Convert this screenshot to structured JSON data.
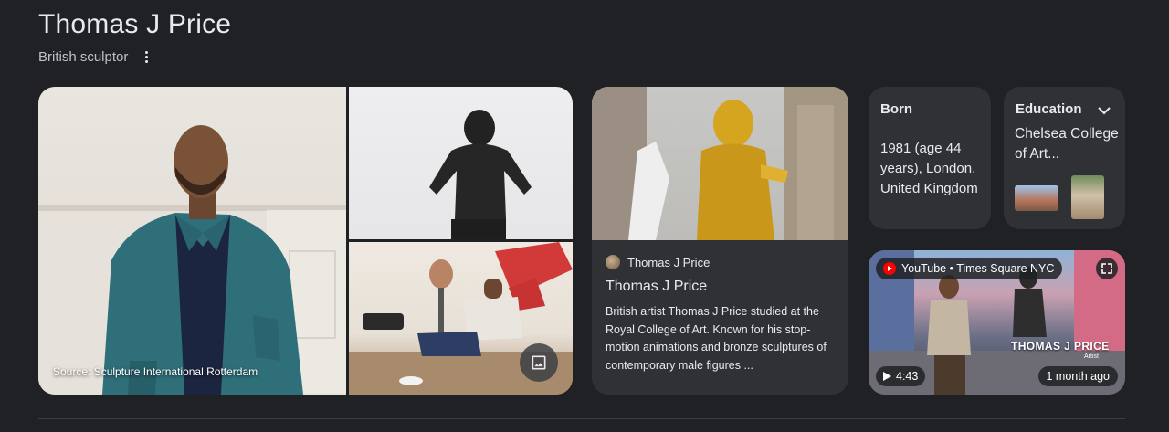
{
  "header": {
    "title": "Thomas J Price",
    "subtitle": "British sculptor"
  },
  "gallery": {
    "source_text": "Source: Sculpture International Rotterdam"
  },
  "article": {
    "source_name": "Thomas J Price",
    "title": "Thomas J Price",
    "snippet": "British artist Thomas J Price studied at the Royal College of Art. Known for his stop-motion animations and bronze sculptures of contemporary male figures ..."
  },
  "born": {
    "label": "Born",
    "value": "1981 (age 44 years), London, United Kingdom"
  },
  "education": {
    "label": "Education",
    "value": "Chelsea College of Art..."
  },
  "video": {
    "source": "YouTube • Times Square NYC",
    "overlay_name": "THOMAS J PRICE",
    "overlay_sub": "Artist",
    "duration": "4:43",
    "age": "1 month ago"
  },
  "colors": {
    "background": "#202124",
    "card": "#303134",
    "text": "#e8eaed",
    "secondary_text": "#bdc1c6",
    "youtube_red": "#ff0000"
  },
  "icons": [
    "more-vert-icon",
    "image-icon",
    "chevron-down-icon",
    "youtube-logo-icon",
    "expand-icon",
    "play-icon"
  ]
}
